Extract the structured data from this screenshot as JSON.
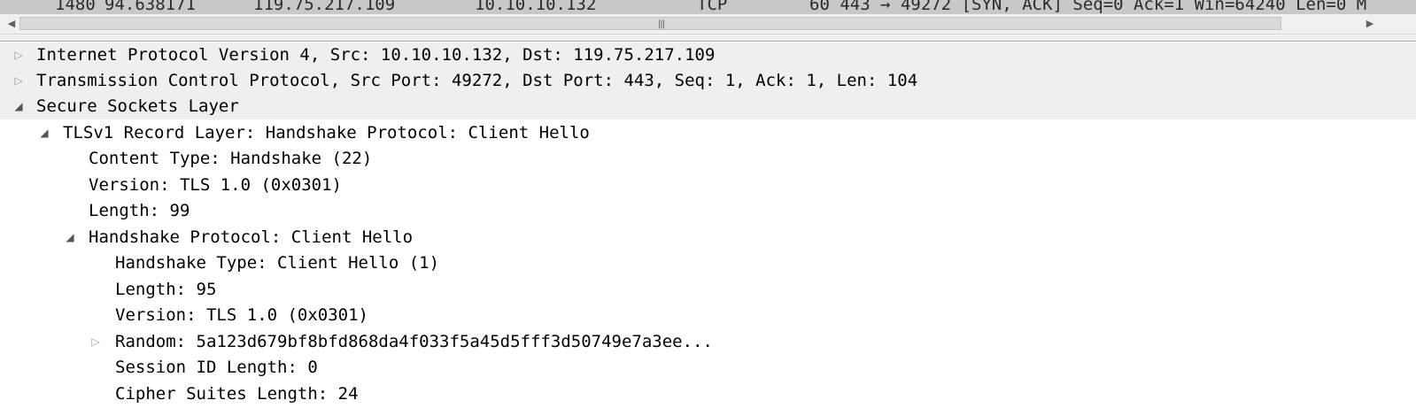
{
  "packet_list": {
    "row": {
      "no": "1480",
      "time": "94.638171",
      "source": "119.75.217.109",
      "destination": "10.10.10.132",
      "protocol": "TCP",
      "info": "60 443 → 49272 [SYN, ACK] Seq=0 Ack=1 Win=64240 Len=0 M"
    }
  },
  "scrollbar": {
    "left_arrow": "◀",
    "right_arrow": "▶",
    "grip": "|||"
  },
  "details": {
    "rows": [
      {
        "label": "Internet Protocol Version 4, Src: 10.10.10.132, Dst: 119.75.217.109",
        "toggle": "▷"
      },
      {
        "label": "Transmission Control Protocol, Src Port: 49272, Dst Port: 443, Seq: 1, Ack: 1, Len: 104",
        "toggle": "▷"
      },
      {
        "label": "Secure Sockets Layer",
        "toggle": "◢"
      },
      {
        "label": "TLSv1 Record Layer: Handshake Protocol: Client Hello",
        "toggle": "◢"
      },
      {
        "label": "Content Type: Handshake (22)"
      },
      {
        "label": "Version: TLS 1.0 (0x0301)"
      },
      {
        "label": "Length: 99"
      },
      {
        "label": "Handshake Protocol: Client Hello",
        "toggle": "◢"
      },
      {
        "label": "Handshake Type: Client Hello (1)"
      },
      {
        "label": "Length: 95"
      },
      {
        "label": "Version: TLS 1.0 (0x0301)"
      },
      {
        "label": "Random: 5a123d679bf8bfd868da4f033f5a45d5fff3d50749e7a3ee...",
        "toggle": "▷"
      },
      {
        "label": "Session ID Length: 0"
      },
      {
        "label": "Cipher Suites Length: 24"
      }
    ]
  }
}
